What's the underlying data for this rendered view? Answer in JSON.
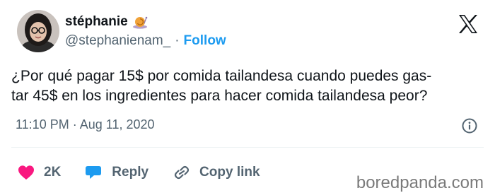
{
  "author": {
    "display_name": "stéphanie",
    "badge_emoji_icon": "snail-icon",
    "handle": "@stephanienam_",
    "separator": "·",
    "follow_label": "Follow"
  },
  "platform_logo_icon": "x-logo-icon",
  "tweet": {
    "lines": [
      "¿Por qué pagar 15$ por comida tailandesa cuando puedes gas-",
      "tar 45$ en los ingredientes para hacer comida tailandesa peor?"
    ],
    "time": "11:10 PM",
    "date_separator": "·",
    "date": "Aug 11, 2020"
  },
  "actions": {
    "likes_count": "2K",
    "reply_label": "Reply",
    "copy_link_label": "Copy link"
  },
  "watermark": "boredpanda.com",
  "colors": {
    "text": "#0f1419",
    "secondary": "#536471",
    "link": "#1d9bf0",
    "like": "#f91880",
    "reply": "#1d9bf0"
  }
}
